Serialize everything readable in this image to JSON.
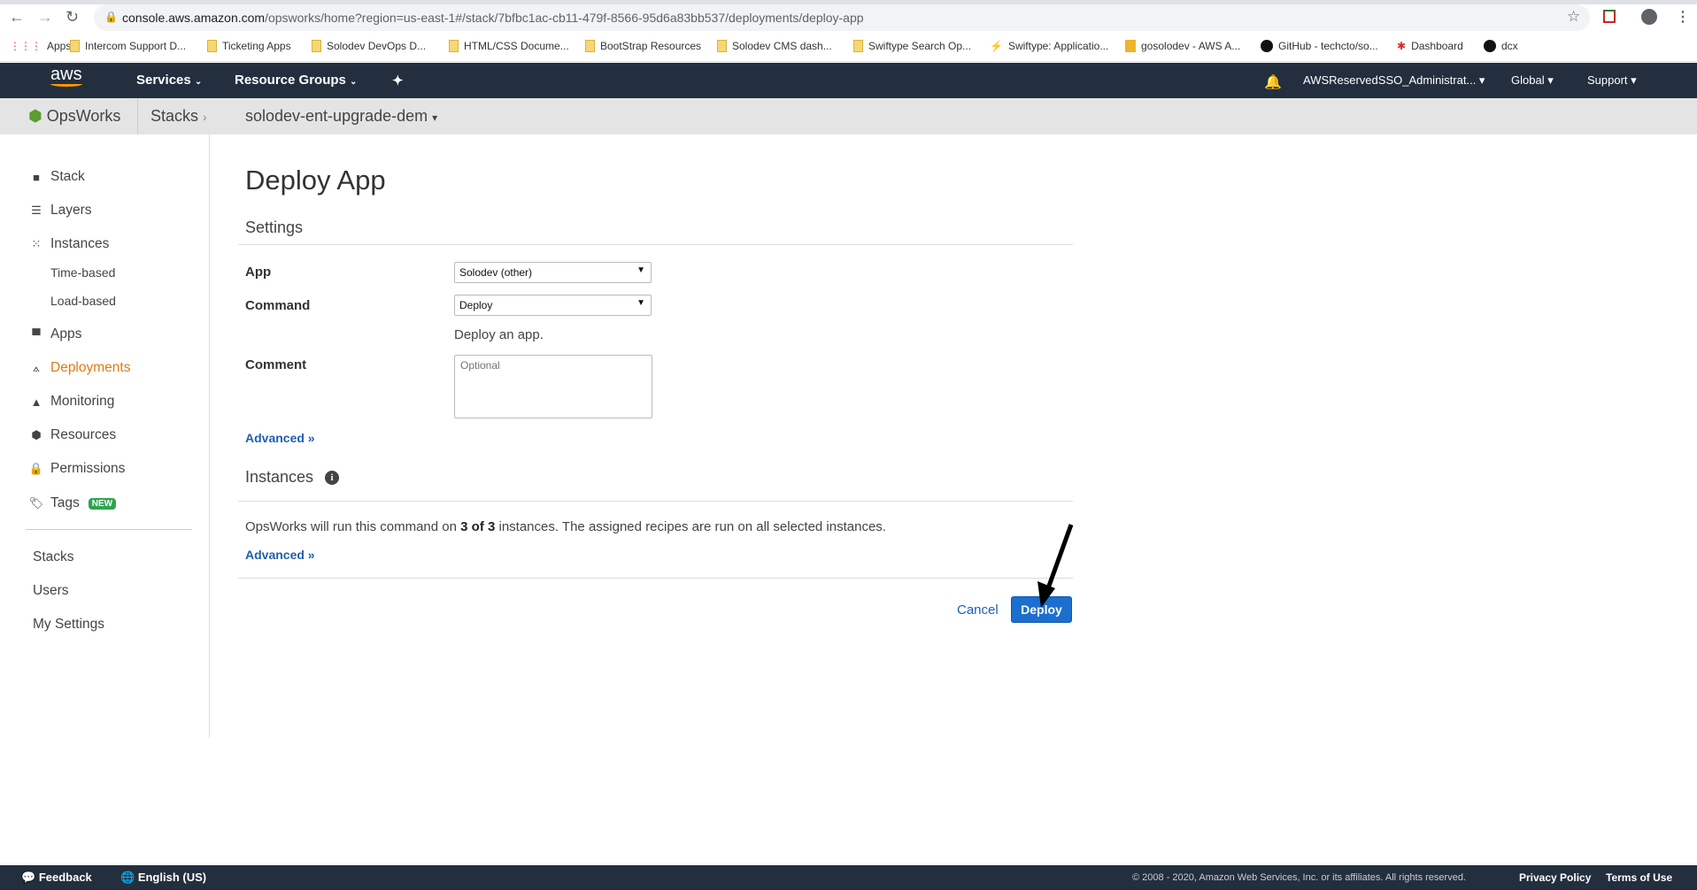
{
  "browser": {
    "url_host": "console.aws.amazon.com",
    "url_path": "/opsworks/home?region=us-east-1#/stack/7bfbc1ac-cb11-479f-8566-95d6a83bb537/deployments/deploy-app",
    "bookmarks": [
      "Apps",
      "Intercom Support D...",
      "Ticketing Apps",
      "Solodev DevOps D...",
      "HTML/CSS Docume...",
      "BootStrap Resources",
      "Solodev CMS dash...",
      "Swiftype Search Op...",
      "Swiftype: Applicatio...",
      "gosolodev - AWS A...",
      "GitHub - techcto/so...",
      "Dashboard",
      "dcx"
    ]
  },
  "awsnav": {
    "logo": "aws",
    "services": "Services",
    "resource_groups": "Resource Groups",
    "account": "AWSReservedSSO_Administrat...",
    "region": "Global",
    "support": "Support"
  },
  "breadcrumb": {
    "service": "OpsWorks",
    "stacks": "Stacks",
    "stack": "solodev-ent-upgrade-dem"
  },
  "sidebar": {
    "items": [
      "Stack",
      "Layers",
      "Instances",
      "Time-based",
      "Load-based",
      "Apps",
      "Deployments",
      "Monitoring",
      "Resources",
      "Permissions",
      "Tags"
    ],
    "tags_badge": "NEW",
    "bottom": [
      "Stacks",
      "Users",
      "My Settings"
    ],
    "active": "Deployments",
    "active_color": "#e07b14"
  },
  "main": {
    "title": "Deploy App",
    "settings_heading": "Settings",
    "app_label": "App",
    "app_value": "Solodev (other)",
    "command_label": "Command",
    "command_value": "Deploy",
    "command_help": "Deploy an app.",
    "comment_label": "Comment",
    "comment_placeholder": "Optional",
    "advanced": "Advanced »",
    "instances_heading": "Instances",
    "instances_text_pre": "OpsWorks will run this command on ",
    "instances_count": "3 of 3",
    "instances_text_post": " instances. The assigned recipes are run on all selected instances.",
    "cancel": "Cancel",
    "deploy": "Deploy"
  },
  "footer": {
    "feedback": "Feedback",
    "language": "English (US)",
    "copyright": "© 2008 - 2020, Amazon Web Services, Inc. or its affiliates. All rights reserved.",
    "privacy": "Privacy Policy",
    "terms": "Terms of Use"
  }
}
